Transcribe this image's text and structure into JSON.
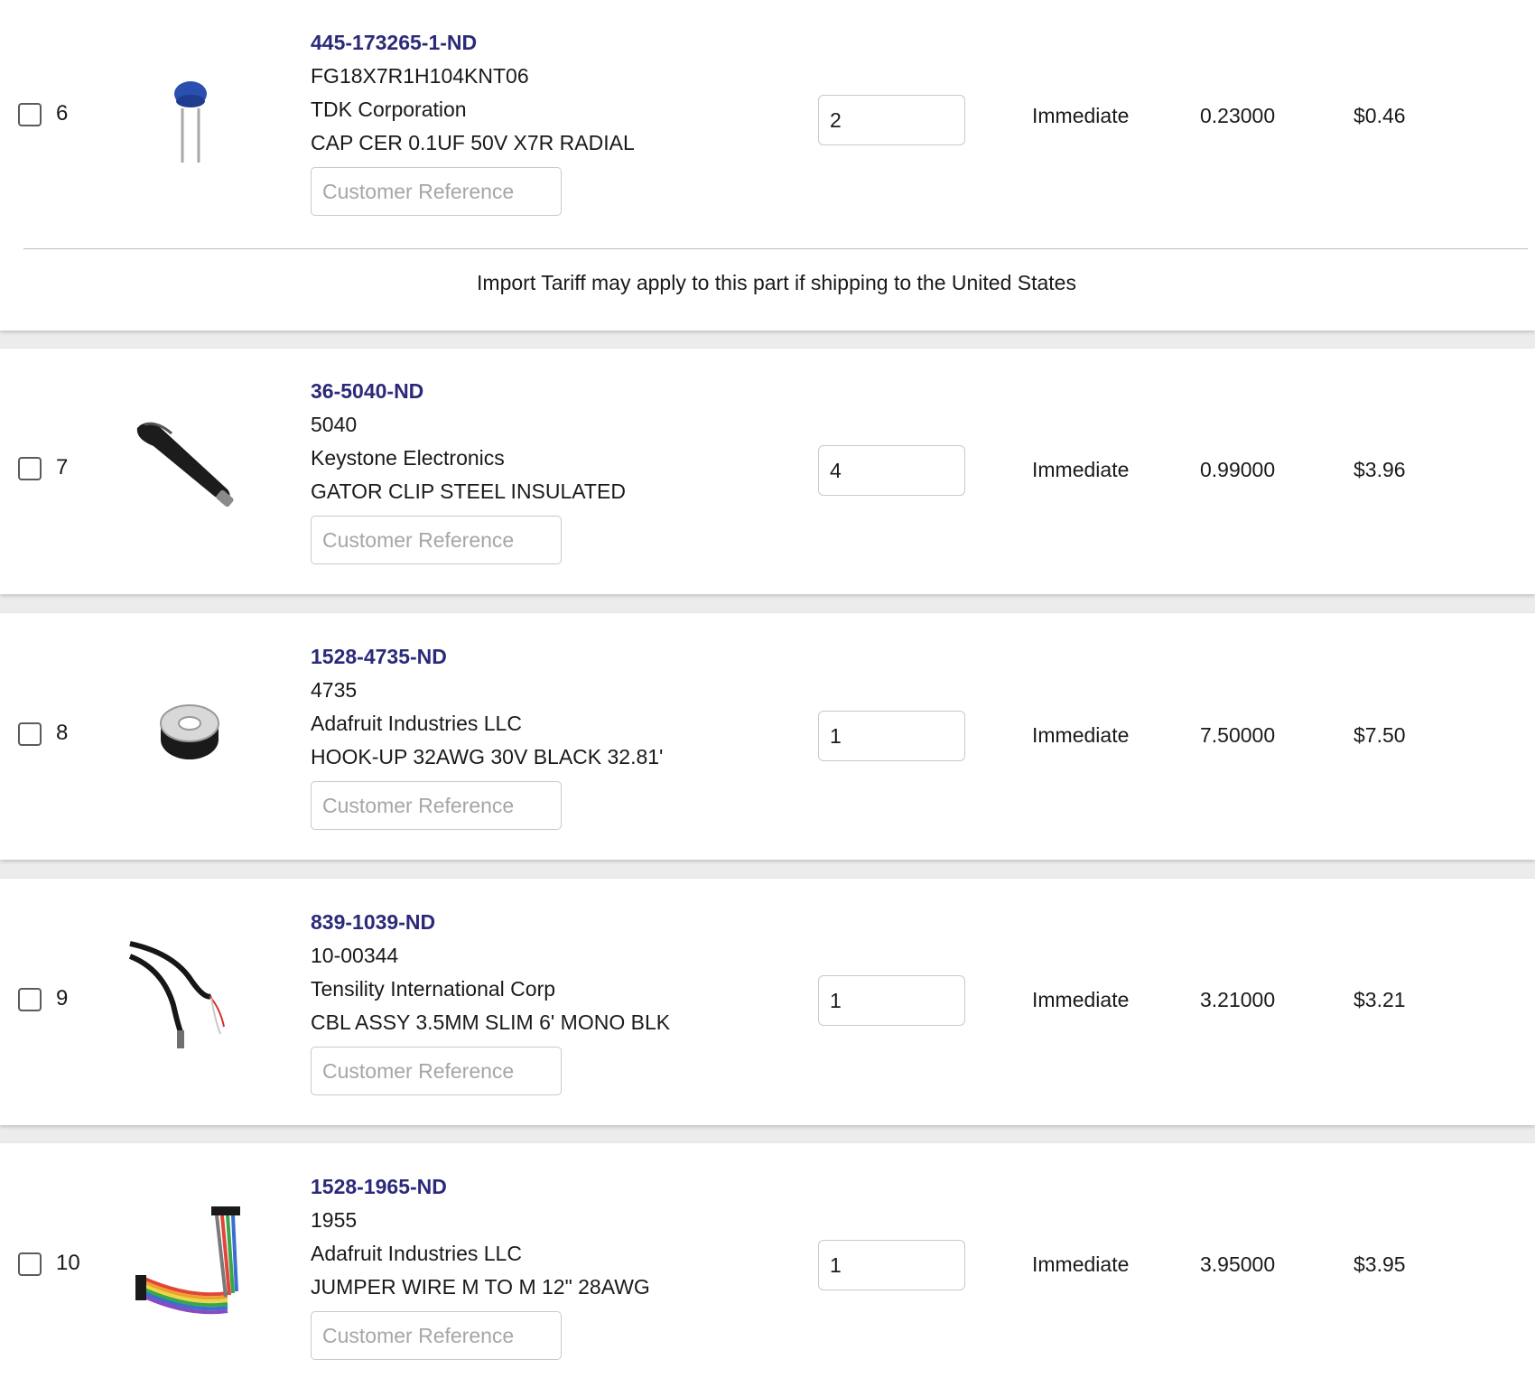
{
  "rows": [
    {
      "index": "6",
      "digikey_pn": "445-173265-1-ND",
      "mfr_pn": "FG18X7R1H104KNT06",
      "manufacturer": "TDK Corporation",
      "description": "CAP CER 0.1UF 50V X7R RADIAL",
      "customer_ref_placeholder": "Customer Reference",
      "quantity": "2",
      "availability": "Immediate",
      "unit_price": "0.23000",
      "extended_price": "$0.46",
      "image_icon": "ceramic-capacitor-icon",
      "note": "Import Tariff may apply to this part if shipping to the United States"
    },
    {
      "index": "7",
      "digikey_pn": "36-5040-ND",
      "mfr_pn": "5040",
      "manufacturer": "Keystone Electronics",
      "description": "GATOR CLIP STEEL INSULATED",
      "customer_ref_placeholder": "Customer Reference",
      "quantity": "4",
      "availability": "Immediate",
      "unit_price": "0.99000",
      "extended_price": "$3.96",
      "image_icon": "alligator-clip-icon"
    },
    {
      "index": "8",
      "digikey_pn": "1528-4735-ND",
      "mfr_pn": "4735",
      "manufacturer": "Adafruit Industries LLC",
      "description": "HOOK-UP 32AWG 30V BLACK 32.81'",
      "customer_ref_placeholder": "Customer Reference",
      "quantity": "1",
      "availability": "Immediate",
      "unit_price": "7.50000",
      "extended_price": "$7.50",
      "image_icon": "wire-spool-icon"
    },
    {
      "index": "9",
      "digikey_pn": "839-1039-ND",
      "mfr_pn": "10-00344",
      "manufacturer": "Tensility International Corp",
      "description": "CBL ASSY 3.5MM SLIM 6' MONO BLK",
      "customer_ref_placeholder": "Customer Reference",
      "quantity": "1",
      "availability": "Immediate",
      "unit_price": "3.21000",
      "extended_price": "$3.21",
      "image_icon": "audio-cable-icon"
    },
    {
      "index": "10",
      "digikey_pn": "1528-1965-ND",
      "mfr_pn": "1955",
      "manufacturer": "Adafruit Industries LLC",
      "description": "JUMPER WIRE M TO M 12\" 28AWG",
      "customer_ref_placeholder": "Customer Reference",
      "quantity": "1",
      "availability": "Immediate",
      "unit_price": "3.95000",
      "extended_price": "$3.95",
      "image_icon": "jumper-wires-icon"
    }
  ],
  "colors": {
    "part_link": "#2b2a7a",
    "page_background": "#ececec",
    "card_background": "#ffffff"
  }
}
